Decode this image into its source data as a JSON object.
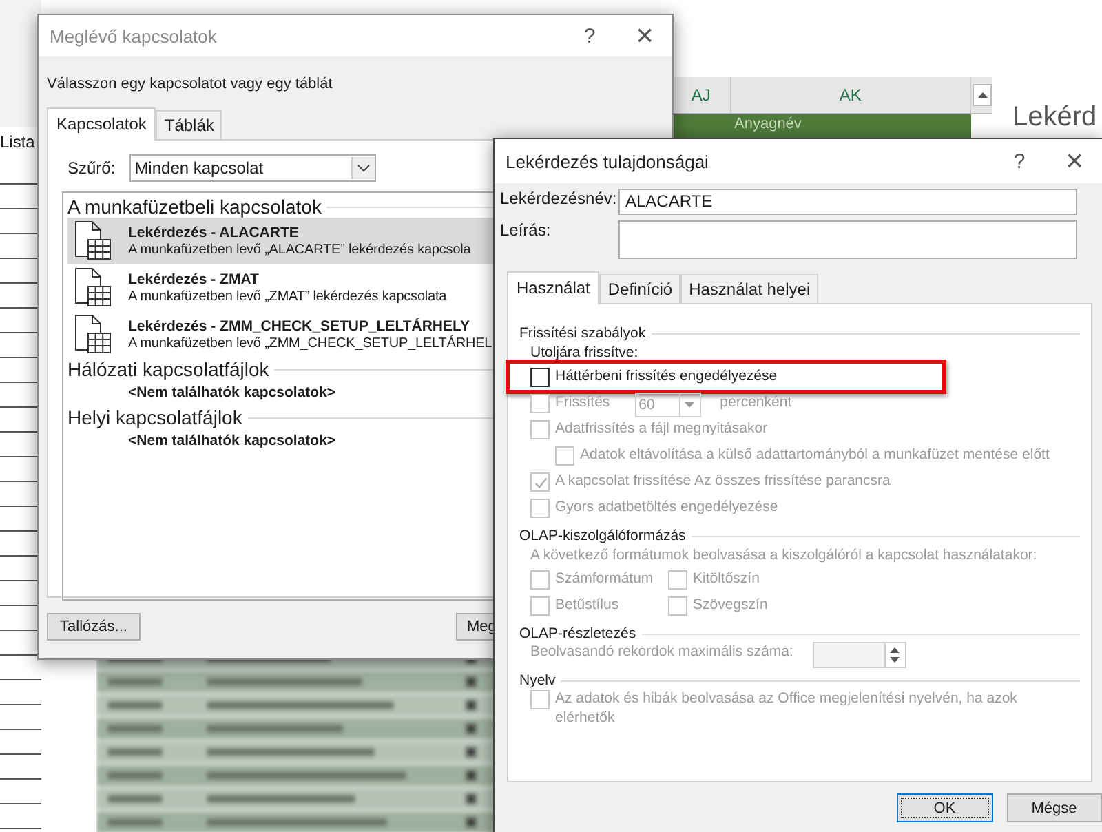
{
  "spreadsheet": {
    "header_cell": "Lista",
    "columns": [
      "AJ",
      "AK"
    ],
    "green_cell": "Anyagnév",
    "heading_fragment": "Lekérd"
  },
  "connections_dialog": {
    "title": "Meglévő kapcsolatok",
    "help": "?",
    "close": "×",
    "prompt": "Válasszon egy kapcsolatot vagy egy táblát",
    "tabs": [
      {
        "label": "Kapcsolatok",
        "selected": true
      },
      {
        "label": "Táblák",
        "selected": false
      }
    ],
    "filter_label": "Szűrő:",
    "filter_value": "Minden kapcsolat",
    "sections": [
      {
        "title": "A munkafüzetbeli kapcsolatok",
        "items": [
          {
            "name": "Lekérdezés - ALACARTE",
            "description": "A munkafüzetben levő „ALACARTE” lekérdezés kapcsola",
            "selected": true
          },
          {
            "name": "Lekérdezés - ZMAT",
            "description": "A munkafüzetben levő „ZMAT” lekérdezés kapcsolata",
            "selected": false
          },
          {
            "name": "Lekérdezés - ZMM_CHECK_SETUP_LELTÁRHELY",
            "description": "A munkafüzetben levő „ZMM_CHECK_SETUP_LELTÁRHEL",
            "selected": false
          }
        ]
      },
      {
        "title": "Hálózati kapcsolatfájlok",
        "empty_text": "<Nem találhatók kapcsolatok>"
      },
      {
        "title": "Helyi kapcsolatfájlok",
        "empty_text": "<Nem találhatók kapcsolatok>"
      }
    ],
    "buttons": [
      "Tallózás...",
      "Meg"
    ]
  },
  "query_dialog": {
    "title": "Lekérdezés tulajdonságai",
    "help": "?",
    "close": "×",
    "name_label": "Lekérdezésnév:",
    "name_value": "ALACARTE",
    "description_label": "Leírás:",
    "tabs": [
      {
        "label": "Használat",
        "selected": true
      },
      {
        "label": "Definíció",
        "selected": false
      },
      {
        "label": "Használat helyei",
        "selected": false
      }
    ],
    "groups": [
      {
        "title": "Frissítési szabályok",
        "rows": [
          {
            "kind": "text",
            "text": "Utoljára frissítve:"
          },
          {
            "kind": "checkbox",
            "label": "Háttérbeni frissítés engedélyezése",
            "checked": false,
            "disabled": false,
            "highlighted": true
          },
          {
            "kind": "interval",
            "label": "Frissítés",
            "value": "60",
            "unit": "percenként",
            "checked": false,
            "disabled": true
          },
          {
            "kind": "checkbox",
            "label": "Adatfrissítés a fájl megnyitásakor",
            "checked": false,
            "disabled": true,
            "children": [
              {
                "label": "Adatok eltávolítása a külső adattartományból a munkafüzet mentése előtt",
                "checked": false,
                "disabled": true
              }
            ]
          },
          {
            "kind": "checkbox",
            "label": "A kapcsolat frissítése Az összes frissítése parancsra",
            "checked": true,
            "disabled": true
          },
          {
            "kind": "checkbox",
            "label": "Gyors adatbetöltés engedélyezése",
            "checked": false,
            "disabled": true
          }
        ]
      },
      {
        "title": "OLAP-kiszolgálóformázás",
        "rows": [
          {
            "kind": "note",
            "text": "A következő formátumok beolvasása a kiszolgálóról a kapcsolat használatakor:"
          },
          {
            "kind": "grid",
            "items": [
              {
                "label": "Számformátum",
                "checked": false,
                "disabled": true
              },
              {
                "label": "Kitöltőszín",
                "checked": false,
                "disabled": true
              },
              {
                "label": "Betűstílus",
                "checked": false,
                "disabled": true
              },
              {
                "label": "Szövegszín",
                "checked": false,
                "disabled": true
              }
            ]
          }
        ]
      },
      {
        "title": "OLAP-részletezés",
        "rows": [
          {
            "kind": "spinner",
            "label": "Beolvasandó rekordok maximális száma:",
            "disabled": true
          }
        ]
      },
      {
        "title": "Nyelv",
        "rows": [
          {
            "kind": "checkbox",
            "label": "Az adatok és hibák beolvasása az Office megjelenítési nyelvén, ha azok elérhetők",
            "checked": false,
            "disabled": true
          }
        ]
      }
    ],
    "buttons": [
      {
        "label": "OK",
        "default": true
      },
      {
        "label": "Mégse",
        "default": false
      }
    ]
  }
}
